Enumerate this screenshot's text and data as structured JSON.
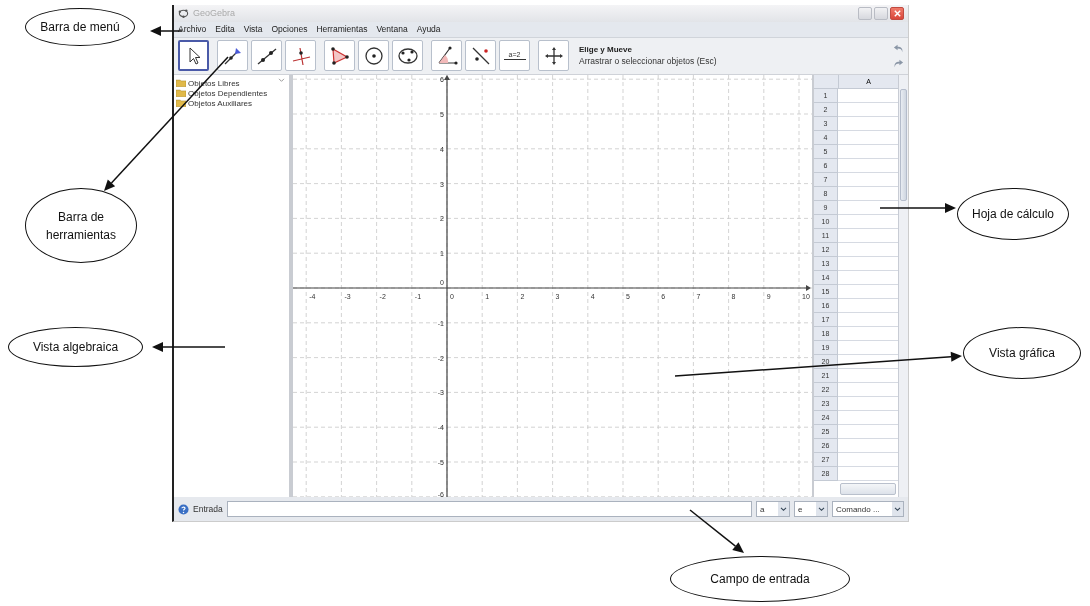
{
  "window": {
    "title": "GeoGebra"
  },
  "menu": [
    "Archivo",
    "Edita",
    "Vista",
    "Opciones",
    "Herramientas",
    "Ventana",
    "Ayuda"
  ],
  "toolbar": {
    "tool_groups": [
      [
        {
          "kind": "move",
          "selected": true
        }
      ],
      [
        {
          "kind": "point",
          "selected": false
        },
        {
          "kind": "line",
          "selected": false
        },
        {
          "kind": "perpendicular",
          "selected": false
        }
      ],
      [
        {
          "kind": "polygon",
          "selected": false
        },
        {
          "kind": "circle",
          "selected": false
        },
        {
          "kind": "conic",
          "selected": false
        }
      ],
      [
        {
          "kind": "angle",
          "selected": false
        },
        {
          "kind": "reflect",
          "selected": false
        },
        {
          "kind": "slider",
          "selected": false,
          "text": "a=2"
        }
      ],
      [
        {
          "kind": "move_view",
          "selected": false
        }
      ]
    ],
    "tool_name": "Elige y Mueve",
    "tool_help": "Arrastrar o seleccionar objetos (Esc)"
  },
  "algebra_view": {
    "folders": [
      "Objetos Libres",
      "Objetos Dependientes",
      "Objetos Auxiliares"
    ]
  },
  "graphics_view": {
    "x_axis_labels": [
      "-4",
      "-3",
      "-2",
      "-1",
      "0",
      "1",
      "2",
      "3",
      "4",
      "5",
      "6",
      "7",
      "8",
      "9",
      "10"
    ],
    "y_axis_labels": [
      "6",
      "5",
      "4",
      "3",
      "2",
      "1",
      "0",
      "-1",
      "-2",
      "-3",
      "-4",
      "-5",
      "-6"
    ]
  },
  "spreadsheet": {
    "column": "A",
    "rows": [
      "1",
      "2",
      "3",
      "4",
      "5",
      "6",
      "7",
      "8",
      "9",
      "10",
      "11",
      "12",
      "13",
      "14",
      "15",
      "16",
      "17",
      "18",
      "19",
      "20",
      "21",
      "22",
      "23",
      "24",
      "25",
      "26",
      "27",
      "28"
    ]
  },
  "input_bar": {
    "label": "Entrada",
    "symbol_1": "a",
    "symbol_2": "e",
    "command_placeholder": "Comando ..."
  },
  "annotations": [
    {
      "label": "Barra de menú"
    },
    {
      "label": "Barra de herramientas"
    },
    {
      "label": "Vista algebraica"
    },
    {
      "label": "Hoja de cálculo"
    },
    {
      "label": "Vista gráfica"
    },
    {
      "label": "Campo de entrada"
    }
  ]
}
